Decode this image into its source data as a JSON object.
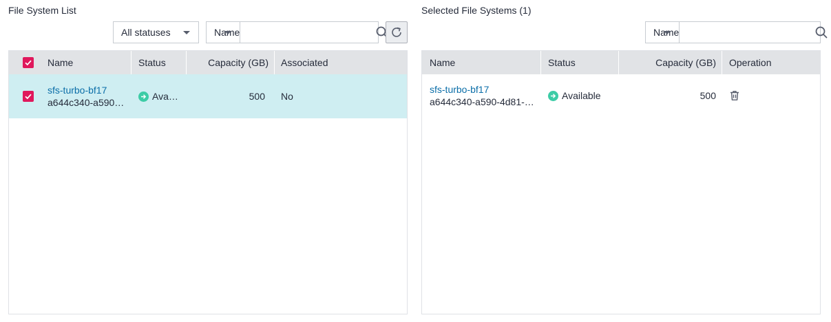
{
  "left_panel": {
    "title": "File System List",
    "status_filter": "All statuses",
    "search_field": "Name",
    "search_value": "",
    "columns": {
      "name": "Name",
      "status": "Status",
      "capacity": "Capacity (GB)",
      "associated": "Associated"
    },
    "rows": [
      {
        "name": "sfs-turbo-bf17",
        "id": "a644c340-a590…",
        "status": "Ava…",
        "capacity": "500",
        "associated": "No",
        "checked": true
      }
    ]
  },
  "right_panel": {
    "title": "Selected File Systems (1)",
    "search_field": "Name",
    "search_value": "",
    "columns": {
      "name": "Name",
      "status": "Status",
      "capacity": "Capacity (GB)",
      "operation": "Operation"
    },
    "rows": [
      {
        "name": "sfs-turbo-bf17",
        "id": "a644c340-a590-4d81-…",
        "status": "Available",
        "capacity": "500"
      }
    ]
  },
  "colors": {
    "accent": "#e0185c",
    "selected_row": "#cfeef2",
    "available": "#3dcca6",
    "link": "#0b6ea8"
  },
  "icons": {
    "search": "search-icon",
    "refresh": "refresh-icon",
    "delete": "trash-icon",
    "status": "arrow-right-circle-icon"
  }
}
